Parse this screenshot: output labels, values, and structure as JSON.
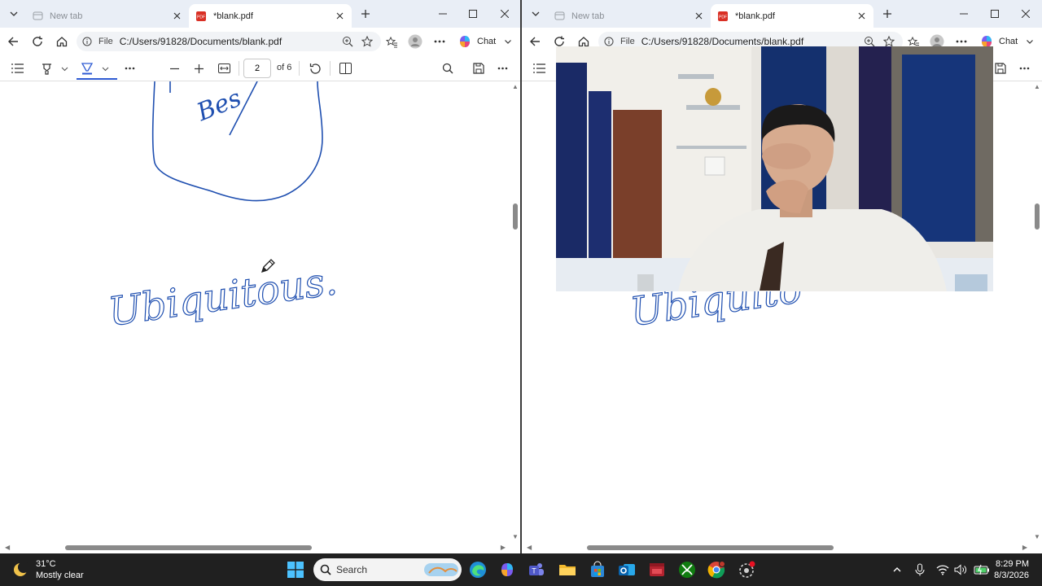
{
  "left_window": {
    "tabs": [
      {
        "title": "New tab",
        "active": false
      },
      {
        "title": "*blank.pdf",
        "active": true
      }
    ],
    "address": {
      "scheme_label": "File",
      "url": "C:/Users/91828/Documents/blank.pdf"
    },
    "chat_label": "Chat",
    "pdf_toolbar": {
      "current_page": "2",
      "page_total_label": "of 6"
    },
    "handwriting": "Ubiquitous.",
    "handwriting_fragment": "Bes"
  },
  "right_window": {
    "tabs": [
      {
        "title": "New tab",
        "active": false
      },
      {
        "title": "*blank.pdf",
        "active": true
      }
    ],
    "address": {
      "scheme_label": "File",
      "url": "C:/Users/91828/Documents/blank.pdf"
    },
    "chat_label": "Chat",
    "handwriting_visible": "Ubiquito"
  },
  "taskbar": {
    "weather": {
      "temp": "31°C",
      "condition": "Mostly clear"
    },
    "search_label": "Search",
    "clock": {
      "time": "8:29 PM",
      "date": "8/3/2026"
    }
  },
  "colors": {
    "ink": "#1f4fb0",
    "accent": "#2f5bd3",
    "taskbar": "#202020",
    "tabbar": "#e9eef6"
  }
}
